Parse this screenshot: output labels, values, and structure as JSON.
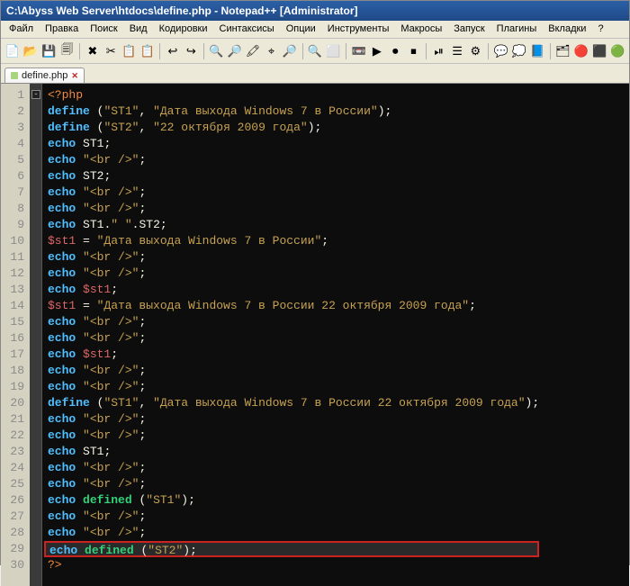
{
  "title": "C:\\Abyss Web Server\\htdocs\\define.php - Notepad++ [Administrator]",
  "menu": [
    "Файл",
    "Правка",
    "Поиск",
    "Вид",
    "Кодировки",
    "Синтаксисы",
    "Опции",
    "Инструменты",
    "Макросы",
    "Запуск",
    "Плагины",
    "Вкладки",
    "?"
  ],
  "toolbar_icons": [
    "📄",
    "📂",
    "💾",
    "🗐",
    "✖",
    "✂",
    "📋",
    "📋",
    "↩",
    "↪",
    "🔍",
    "🔎",
    "🖍",
    "⌖",
    "🔎",
    "🔍",
    "⬜",
    "📼",
    "▶",
    "⏺",
    "⏹",
    "⏯",
    "☰",
    "⚙",
    "💬",
    "💭",
    "📘",
    "🗂",
    "🔴",
    "⬛",
    "🟢"
  ],
  "tab": {
    "label": "define.php",
    "close": "✕"
  },
  "code_lines": [
    {
      "n": 1,
      "t": [
        [
          "tagc",
          "<?php"
        ]
      ]
    },
    {
      "n": 2,
      "t": [
        [
          "k-blue",
          "define"
        ],
        [
          "plain",
          " "
        ],
        [
          "punct",
          "("
        ],
        [
          "str",
          "\"ST1\""
        ],
        [
          "punct",
          ", "
        ],
        [
          "str",
          "\"Дата выхода Windows 7 в России\""
        ],
        [
          "punct",
          ");"
        ]
      ]
    },
    {
      "n": 3,
      "t": [
        [
          "k-blue",
          "define"
        ],
        [
          "plain",
          " "
        ],
        [
          "punct",
          "("
        ],
        [
          "str",
          "\"ST2\""
        ],
        [
          "punct",
          ", "
        ],
        [
          "str",
          "\"22 октября 2009 года\""
        ],
        [
          "punct",
          ");"
        ]
      ]
    },
    {
      "n": 4,
      "t": [
        [
          "k-blue",
          "echo"
        ],
        [
          "plain",
          " ST1"
        ],
        [
          "punct",
          ";"
        ]
      ]
    },
    {
      "n": 5,
      "t": [
        [
          "k-blue",
          "echo"
        ],
        [
          "plain",
          " "
        ],
        [
          "str",
          "\"<br />\""
        ],
        [
          "punct",
          ";"
        ]
      ]
    },
    {
      "n": 6,
      "t": [
        [
          "k-blue",
          "echo"
        ],
        [
          "plain",
          " ST2"
        ],
        [
          "punct",
          ";"
        ]
      ]
    },
    {
      "n": 7,
      "t": [
        [
          "k-blue",
          "echo"
        ],
        [
          "plain",
          " "
        ],
        [
          "str",
          "\"<br />\""
        ],
        [
          "punct",
          ";"
        ]
      ]
    },
    {
      "n": 8,
      "t": [
        [
          "k-blue",
          "echo"
        ],
        [
          "plain",
          " "
        ],
        [
          "str",
          "\"<br />\""
        ],
        [
          "punct",
          ";"
        ]
      ]
    },
    {
      "n": 9,
      "t": [
        [
          "k-blue",
          "echo"
        ],
        [
          "plain",
          " ST1"
        ],
        [
          "punct",
          "."
        ],
        [
          "str",
          "\" \""
        ],
        [
          "punct",
          "."
        ],
        [
          "plain",
          "ST2"
        ],
        [
          "punct",
          ";"
        ]
      ]
    },
    {
      "n": 10,
      "t": [
        [
          "var",
          "$st1"
        ],
        [
          "plain",
          " = "
        ],
        [
          "str",
          "\"Дата выхода Windows 7 в России\""
        ],
        [
          "punct",
          ";"
        ]
      ]
    },
    {
      "n": 11,
      "t": [
        [
          "k-blue",
          "echo"
        ],
        [
          "plain",
          " "
        ],
        [
          "str",
          "\"<br />\""
        ],
        [
          "punct",
          ";"
        ]
      ]
    },
    {
      "n": 12,
      "t": [
        [
          "k-blue",
          "echo"
        ],
        [
          "plain",
          " "
        ],
        [
          "str",
          "\"<br />\""
        ],
        [
          "punct",
          ";"
        ]
      ]
    },
    {
      "n": 13,
      "t": [
        [
          "k-blue",
          "echo"
        ],
        [
          "plain",
          " "
        ],
        [
          "var",
          "$st1"
        ],
        [
          "punct",
          ";"
        ]
      ]
    },
    {
      "n": 14,
      "t": [
        [
          "var",
          "$st1"
        ],
        [
          "plain",
          " = "
        ],
        [
          "str",
          "\"Дата выхода Windows 7 в России 22 октября 2009 года\""
        ],
        [
          "punct",
          ";"
        ]
      ]
    },
    {
      "n": 15,
      "t": [
        [
          "k-blue",
          "echo"
        ],
        [
          "plain",
          " "
        ],
        [
          "str",
          "\"<br />\""
        ],
        [
          "punct",
          ";"
        ]
      ]
    },
    {
      "n": 16,
      "t": [
        [
          "k-blue",
          "echo"
        ],
        [
          "plain",
          " "
        ],
        [
          "str",
          "\"<br />\""
        ],
        [
          "punct",
          ";"
        ]
      ]
    },
    {
      "n": 17,
      "t": [
        [
          "k-blue",
          "echo"
        ],
        [
          "plain",
          " "
        ],
        [
          "var",
          "$st1"
        ],
        [
          "punct",
          ";"
        ]
      ]
    },
    {
      "n": 18,
      "t": [
        [
          "k-blue",
          "echo"
        ],
        [
          "plain",
          " "
        ],
        [
          "str",
          "\"<br />\""
        ],
        [
          "punct",
          ";"
        ]
      ]
    },
    {
      "n": 19,
      "t": [
        [
          "k-blue",
          "echo"
        ],
        [
          "plain",
          " "
        ],
        [
          "str",
          "\"<br />\""
        ],
        [
          "punct",
          ";"
        ]
      ]
    },
    {
      "n": 20,
      "t": [
        [
          "k-blue",
          "define"
        ],
        [
          "plain",
          " "
        ],
        [
          "punct",
          "("
        ],
        [
          "str",
          "\"ST1\""
        ],
        [
          "punct",
          ", "
        ],
        [
          "str",
          "\"Дата выхода Windows 7 в России 22 октября 2009 года\""
        ],
        [
          "punct",
          ");"
        ]
      ]
    },
    {
      "n": 21,
      "t": [
        [
          "k-blue",
          "echo"
        ],
        [
          "plain",
          " "
        ],
        [
          "str",
          "\"<br />\""
        ],
        [
          "punct",
          ";"
        ]
      ]
    },
    {
      "n": 22,
      "t": [
        [
          "k-blue",
          "echo"
        ],
        [
          "plain",
          " "
        ],
        [
          "str",
          "\"<br />\""
        ],
        [
          "punct",
          ";"
        ]
      ]
    },
    {
      "n": 23,
      "t": [
        [
          "k-blue",
          "echo"
        ],
        [
          "plain",
          " ST1"
        ],
        [
          "punct",
          ";"
        ]
      ]
    },
    {
      "n": 24,
      "t": [
        [
          "k-blue",
          "echo"
        ],
        [
          "plain",
          " "
        ],
        [
          "str",
          "\"<br />\""
        ],
        [
          "punct",
          ";"
        ]
      ]
    },
    {
      "n": 25,
      "t": [
        [
          "k-blue",
          "echo"
        ],
        [
          "plain",
          " "
        ],
        [
          "str",
          "\"<br />\""
        ],
        [
          "punct",
          ";"
        ]
      ]
    },
    {
      "n": 26,
      "t": [
        [
          "k-blue",
          "echo"
        ],
        [
          "plain",
          " "
        ],
        [
          "k-green",
          "defined"
        ],
        [
          "plain",
          " "
        ],
        [
          "punct",
          "("
        ],
        [
          "str",
          "\"ST1\""
        ],
        [
          "punct",
          ");"
        ]
      ]
    },
    {
      "n": 27,
      "t": [
        [
          "k-blue",
          "echo"
        ],
        [
          "plain",
          " "
        ],
        [
          "str",
          "\"<br />\""
        ],
        [
          "punct",
          ";"
        ]
      ]
    },
    {
      "n": 28,
      "t": [
        [
          "k-blue",
          "echo"
        ],
        [
          "plain",
          " "
        ],
        [
          "str",
          "\"<br />\""
        ],
        [
          "punct",
          ";"
        ]
      ]
    },
    {
      "n": 29,
      "hl": true,
      "t": [
        [
          "k-blue",
          "echo"
        ],
        [
          "plain",
          " "
        ],
        [
          "k-green",
          "defined"
        ],
        [
          "plain",
          " "
        ],
        [
          "punct",
          "("
        ],
        [
          "str",
          "\"ST2\""
        ],
        [
          "punct",
          ");"
        ]
      ]
    },
    {
      "n": 30,
      "t": [
        [
          "tagc",
          "?>"
        ]
      ]
    }
  ]
}
